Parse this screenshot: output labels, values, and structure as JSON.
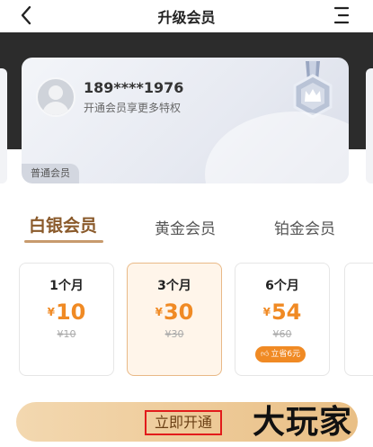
{
  "header": {
    "title": "升级会员"
  },
  "profile": {
    "phone": "189****1976",
    "subtitle": "开通会员享更多特权",
    "badge": "普通会员"
  },
  "tabs": [
    {
      "label": "白银会员",
      "active": true
    },
    {
      "label": "黄金会员",
      "active": false
    },
    {
      "label": "铂金会员",
      "active": false
    }
  ],
  "plans": [
    {
      "name": "1个月",
      "currency": "¥",
      "price": "10",
      "original": "¥10",
      "selected": false
    },
    {
      "name": "3个月",
      "currency": "¥",
      "price": "30",
      "original": "¥30",
      "selected": true
    },
    {
      "name": "6个月",
      "currency": "¥",
      "price": "54",
      "original": "¥60",
      "badge": "立省6元",
      "selected": false
    }
  ],
  "cta": {
    "label": "立即开通"
  },
  "watermark": "大玩家",
  "colors": {
    "accent": "#f08a24",
    "tab_active": "#8a5a2b",
    "cta_start": "#f3d8b0",
    "cta_end": "#e9bf85"
  },
  "icons": {
    "back": "chevron-left-icon",
    "menu": "menu-icon",
    "medal": "medal-icon",
    "avatar": "user-avatar-icon",
    "thumb": "thumbs-up-icon"
  }
}
